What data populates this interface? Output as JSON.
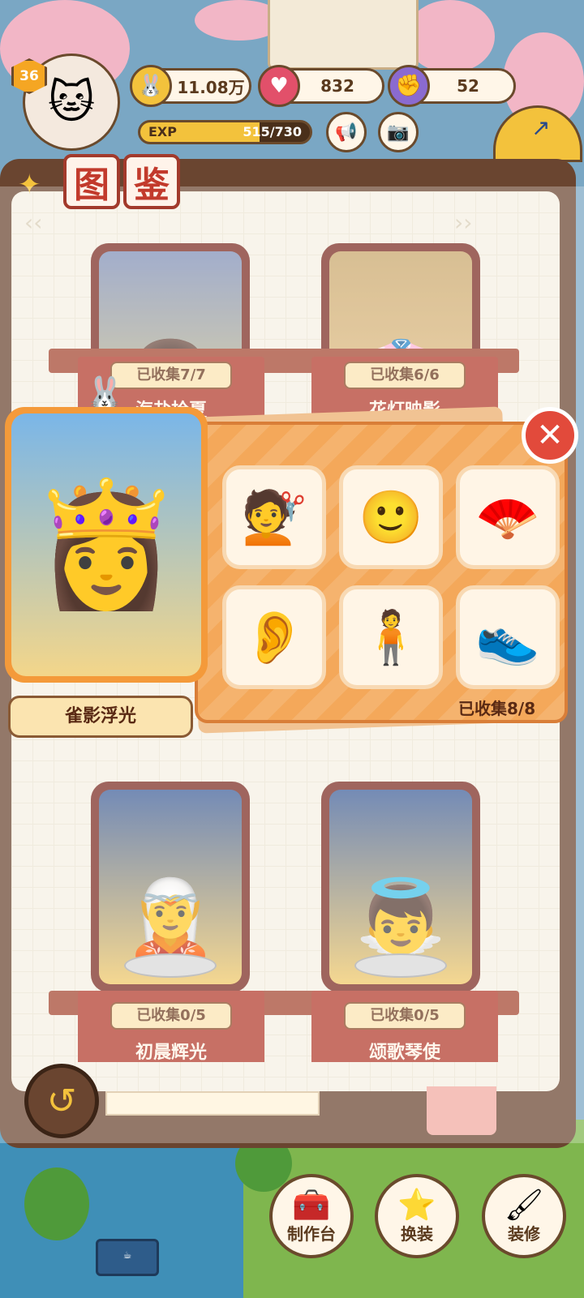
{
  "hud": {
    "level": "36",
    "coins": "11.08万",
    "hearts": "832",
    "energy": "52",
    "exp_label": "EXP",
    "exp_current": "515",
    "exp_max": "/730",
    "exp_progress": 0.705
  },
  "book": {
    "title_chars": [
      "图",
      "鉴"
    ]
  },
  "cards": [
    {
      "collected": "已收集7/7",
      "name": "海盐拾夏"
    },
    {
      "collected": "已收集6/6",
      "name": "花灯映影"
    },
    {
      "collected": "已收集0/5",
      "name": "初晨辉光"
    },
    {
      "collected": "已收集0/5",
      "name": "颂歌琴使"
    }
  ],
  "popup": {
    "outfit_name": "雀影浮光",
    "collected": "已收集8/8",
    "close_symbol": "✕",
    "items": [
      "hair-icon",
      "face-icon",
      "accessory-icon",
      "ears-icon",
      "body-icon",
      "shoes-icon"
    ]
  },
  "nav": {
    "craft": "制作台",
    "dress": "换装",
    "decorate": "装修"
  }
}
